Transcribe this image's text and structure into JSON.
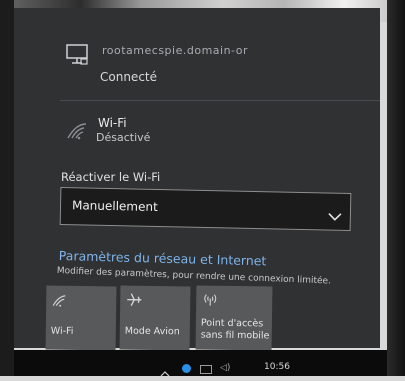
{
  "network": {
    "name": "rootamecspie.domain-or",
    "status": "Connecté",
    "icon": "ethernet-monitor-icon"
  },
  "wifi": {
    "title": "Wi-Fi",
    "status": "Désactivé",
    "icon": "wifi-off-icon"
  },
  "reactivate": {
    "label": "Réactiver le Wi-Fi",
    "selected": "Manuellement"
  },
  "settings": {
    "link": "Paramètres du réseau et Internet",
    "description": "Modifier des paramètres, pour rendre une connexion limitée."
  },
  "quick_actions": [
    {
      "label": "Wi-Fi",
      "icon": "wifi-icon"
    },
    {
      "label": "Mode Avion",
      "icon": "airplane-icon"
    },
    {
      "label_line1": "Point d'accès",
      "label_line2": "sans fil mobile",
      "icon": "hotspot-icon"
    }
  ],
  "taskbar": {
    "time": "10:56"
  },
  "colors": {
    "panel": "#2f3133",
    "accent_link": "#7fb4ea",
    "tile": "#58595b"
  }
}
